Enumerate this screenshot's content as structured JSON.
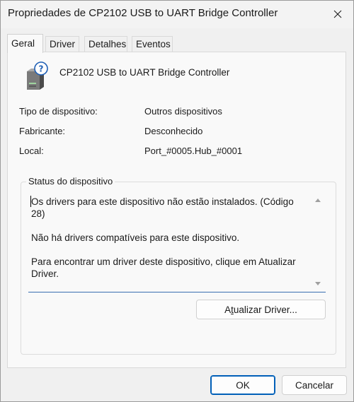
{
  "window": {
    "title": "Propriedades de CP2102 USB to UART Bridge Controller",
    "close_icon": "close-icon"
  },
  "tabs": [
    {
      "label": "Geral",
      "active": true
    },
    {
      "label": "Driver",
      "active": false
    },
    {
      "label": "Detalhes",
      "active": false
    },
    {
      "label": "Eventos",
      "active": false
    }
  ],
  "device": {
    "icon": "unknown-device-icon",
    "name": "CP2102 USB to UART Bridge Controller"
  },
  "properties": [
    {
      "label": "Tipo de dispositivo:",
      "value": "Outros dispositivos"
    },
    {
      "label": "Fabricante:",
      "value": "Desconhecido"
    },
    {
      "label": "Local:",
      "value": "Port_#0005.Hub_#0001"
    }
  ],
  "status": {
    "legend": "Status do dispositivo",
    "lines": [
      "Os drivers para este dispositivo não estão instalados. (Código 28)",
      "Não há drivers compatíveis para este dispositivo.",
      "Para encontrar um driver deste dispositivo, clique em Atualizar Driver."
    ],
    "update_button_prefix": "A",
    "update_button_underlined": "t",
    "update_button_suffix": "ualizar Driver..."
  },
  "footer": {
    "ok_label": "OK",
    "cancel_label": "Cancelar"
  },
  "colors": {
    "accent": "#005fb8",
    "text_underline": "#3a6fb0",
    "background": "#f0f0f0",
    "panel": "#f9f9f9"
  }
}
